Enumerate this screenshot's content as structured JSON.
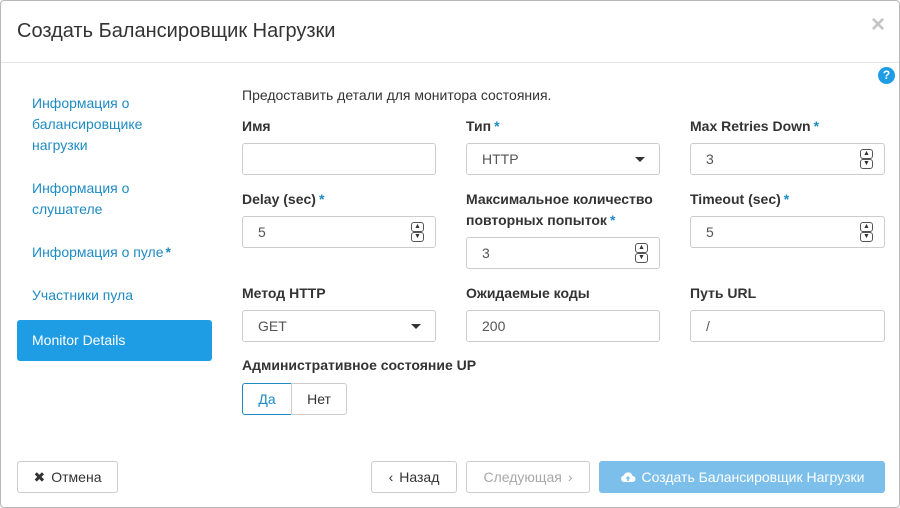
{
  "modal": {
    "title": "Создать Балансировщик Нагрузки",
    "close_glyph": "×",
    "help_glyph": "?"
  },
  "nav": {
    "items": [
      {
        "label": "Информация о балансировщике нагрузки"
      },
      {
        "label": "Информация о слушателе"
      },
      {
        "label": "Информация о пуле",
        "required": "*"
      },
      {
        "label": "Участники пула"
      },
      {
        "label": "Monitor Details",
        "active": true
      }
    ]
  },
  "form": {
    "description": "Предоставить детали для монитора состояния.",
    "required_mark": "*",
    "name": {
      "label": "Имя",
      "value": ""
    },
    "type": {
      "label": "Тип",
      "value": "HTTP"
    },
    "max_retries_down": {
      "label": "Max Retries Down",
      "value": "3"
    },
    "delay": {
      "label": "Delay (sec)",
      "value": "5"
    },
    "max_retries": {
      "label_line1": "Максимальное количество",
      "label_line2": "повторных попыток",
      "value": "3"
    },
    "timeout": {
      "label": "Timeout (sec)",
      "value": "5"
    },
    "http_method": {
      "label": "Метод HTTP",
      "value": "GET"
    },
    "expected_codes": {
      "label": "Ожидаемые коды",
      "value": "200"
    },
    "url_path": {
      "label": "Путь URL",
      "value": "/"
    },
    "admin_state": {
      "label": "Административное состояние UP",
      "yes": "Да",
      "no": "Нет",
      "selected": "Да"
    }
  },
  "footer": {
    "cancel": "Отмена",
    "back": "Назад",
    "next": "Следующая",
    "create": "Создать Балансировщик Нагрузки"
  },
  "icons": {
    "cancel": "close-icon",
    "back": "chevron-left-icon",
    "next": "chevron-right-icon",
    "create": "cloud-upload-icon",
    "spin_up": "▲",
    "spin_down": "▼"
  },
  "colors": {
    "accent": "#1e9de5",
    "link": "#1e8bc3",
    "primary_disabled": "#7bbfea"
  }
}
